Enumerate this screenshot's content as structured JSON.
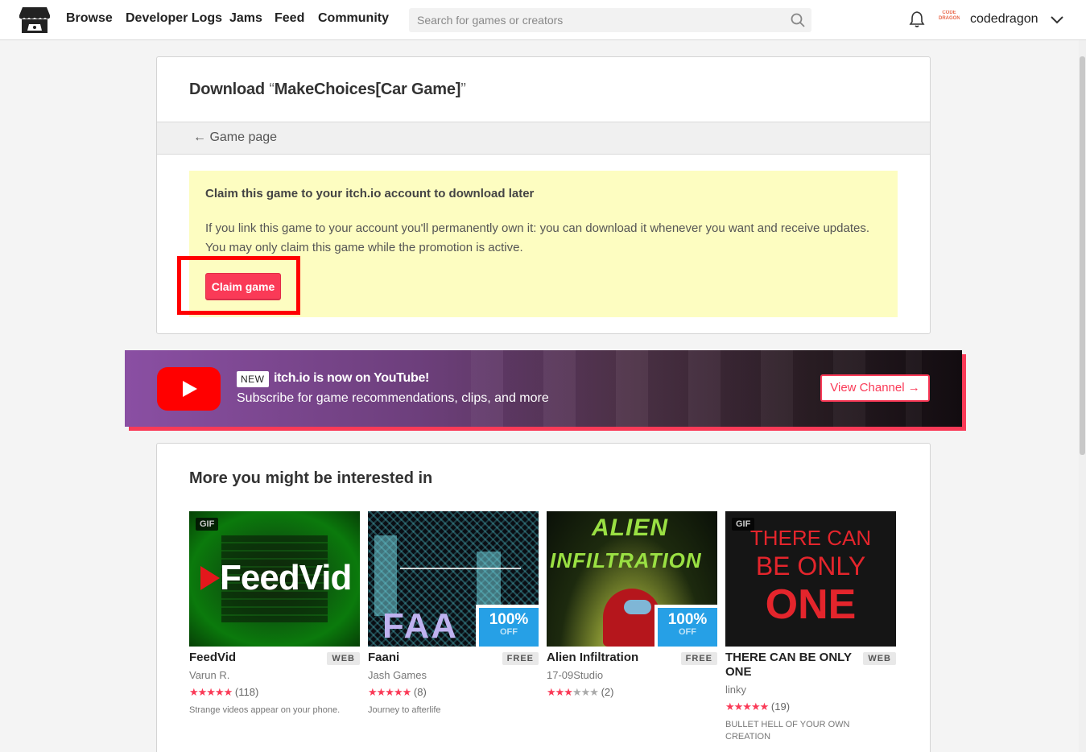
{
  "header": {
    "nav": [
      "Browse",
      "Developer Logs",
      "Jams",
      "Feed",
      "Community"
    ],
    "search_placeholder": "Search for games or creators",
    "avatar_text": "CODE DRAGON",
    "username": "codedragon"
  },
  "download": {
    "title_prefix": "Download ",
    "quote_open": "“",
    "game_name": "MakeChoices[Car Game]",
    "quote_close": "”",
    "back_link": "← Game page",
    "claim_heading": "Claim this game to your itch.io account to download later",
    "claim_text": "If you link this game to your account you'll permanently own it: you can download it whenever you want and receive updates. You may only claim this game while the promotion is active.",
    "claim_button": "Claim game"
  },
  "banner": {
    "badge": "NEW",
    "title": "itch.io is now on YouTube!",
    "subtitle": "Subscribe for game recommendations, clips, and more",
    "button": "View Channel →"
  },
  "recommendations": {
    "title": "More you might be interested in",
    "games": [
      {
        "title": "FeedVid",
        "platform": "WEB",
        "author": "Varun R.",
        "stars": "★★★★★",
        "empty_stars": "",
        "rating_count": "(118)",
        "desc": "Strange videos appear on your phone.",
        "gif": "GIF",
        "thumb_text": "FeedVid"
      },
      {
        "title": "Faani",
        "platform": "FREE",
        "author": "Jash Games",
        "stars": "★★★★★",
        "empty_stars": "",
        "rating_count": "(8)",
        "desc": "Journey to afterlife",
        "sale_pct": "100%",
        "sale_off": "OFF",
        "thumb_text": "FAA"
      },
      {
        "title": "Alien Infiltration",
        "platform": "FREE",
        "author": "17-09Studio",
        "stars": "★★★",
        "empty_stars": "★★★",
        "rating_count": "(2)",
        "desc": "",
        "sale_pct": "100%",
        "sale_off": "OFF",
        "thumb_text_1": "ALIEN",
        "thumb_text_2": "INFILTRATION"
      },
      {
        "title": "THERE CAN BE ONLY ONE",
        "platform": "WEB",
        "author": "linky",
        "stars": "★★★★★",
        "empty_stars": "",
        "rating_count": "(19)",
        "desc": "BULLET HELL OF YOUR OWN CREATION",
        "gif": "GIF",
        "thumb_text_1": "THERE CAN",
        "thumb_text_2": "BE ONLY",
        "thumb_text_3": "ONE"
      }
    ]
  },
  "colors": {
    "accent": "#fa3a57",
    "claim_bg": "#fdfdc1",
    "sale": "#26a0e6",
    "highlight": "#ff0000"
  }
}
